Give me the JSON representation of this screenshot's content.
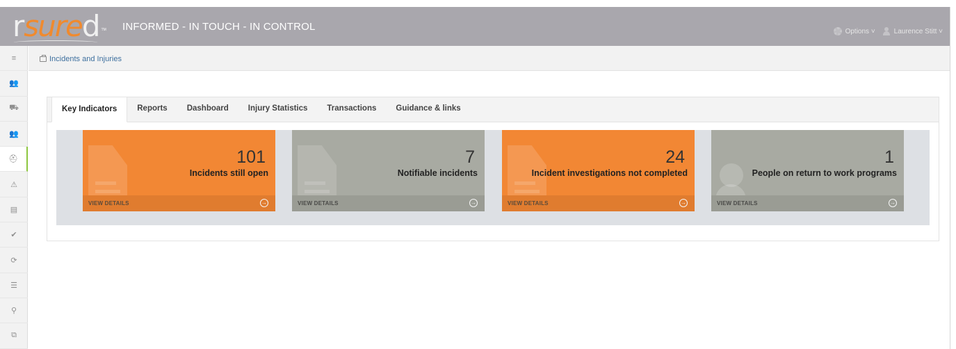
{
  "header": {
    "logo": {
      "r": "r",
      "sure": "sure",
      "d": "d",
      "tm": "TM"
    },
    "tagline": "INFORMED - IN TOUCH - IN CONTROL",
    "options_label": "Options ˅",
    "user_label": "Laurence Stitt ˅"
  },
  "sidebar": {
    "items": [
      {
        "icon": "menu-icon",
        "glyph": "≡"
      },
      {
        "icon": "users-icon",
        "glyph": "👥"
      },
      {
        "icon": "truck-icon",
        "glyph": "⛟"
      },
      {
        "icon": "group-icon",
        "glyph": "👥"
      },
      {
        "icon": "first-aid-kit-icon",
        "glyph": "⛑",
        "active": true
      },
      {
        "icon": "warning-icon",
        "glyph": "⚠"
      },
      {
        "icon": "document-icon",
        "glyph": "▤"
      },
      {
        "icon": "checkmark-icon",
        "glyph": "✔"
      },
      {
        "icon": "refresh-icon",
        "glyph": "⟳"
      },
      {
        "icon": "list-icon",
        "glyph": "☰"
      },
      {
        "icon": "location-icon",
        "glyph": "⚲"
      },
      {
        "icon": "copy-icon",
        "glyph": "⧉"
      }
    ]
  },
  "breadcrumb": {
    "label": "Incidents and Injuries"
  },
  "tabs": [
    {
      "label": "Key Indicators",
      "active": true
    },
    {
      "label": "Reports"
    },
    {
      "label": "Dashboard"
    },
    {
      "label": "Injury Statistics"
    },
    {
      "label": "Transactions"
    },
    {
      "label": "Guidance & links"
    }
  ],
  "tiles": [
    {
      "value": "101",
      "label": "Incidents still open",
      "footer": "VIEW DETAILS",
      "color": "#f28734",
      "icon": "document-icon"
    },
    {
      "value": "7",
      "label": "Notifiable incidents",
      "footer": "VIEW DETAILS",
      "color": "#a8aaa2",
      "icon": "document-icon"
    },
    {
      "value": "24",
      "label": "Incident investigations not completed",
      "footer": "VIEW DETAILS",
      "color": "#f28734",
      "icon": "document-icon"
    },
    {
      "value": "1",
      "label": "People on return to work programs",
      "footer": "VIEW DETAILS",
      "color": "#a8aaa2",
      "icon": "person-icon"
    }
  ],
  "colors": {
    "accent_orange": "#f28734",
    "tile_grey": "#a8aaa2",
    "header_bg": "#a9a7ad",
    "active_marker": "#8dc63f"
  }
}
